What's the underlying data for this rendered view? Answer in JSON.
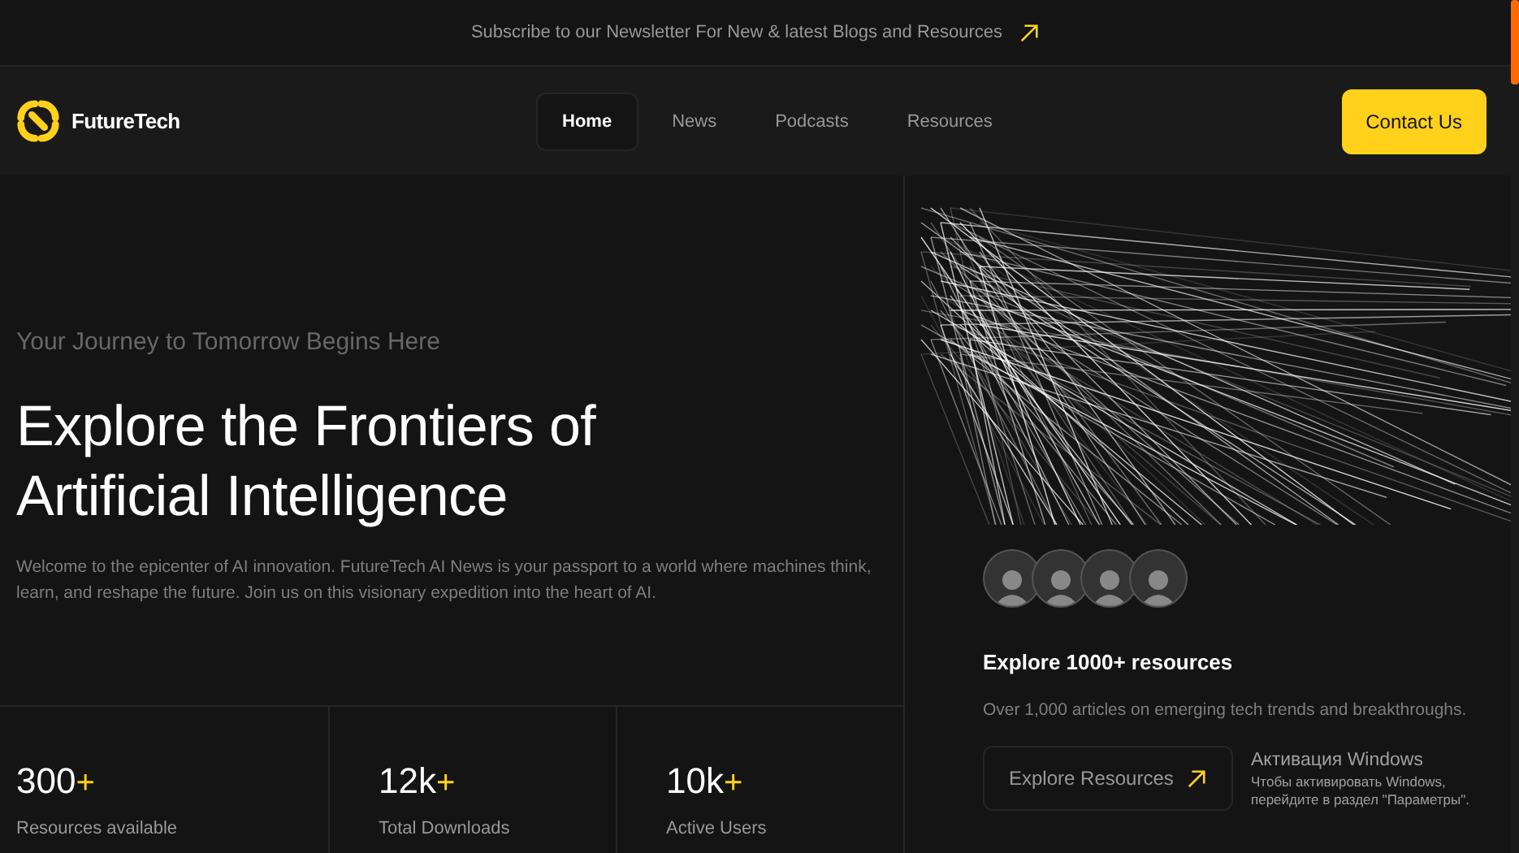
{
  "banner": {
    "text": "Subscribe to our Newsletter For New & latest Blogs and Resources"
  },
  "header": {
    "logo": "FutureTech",
    "nav": [
      {
        "label": "Home",
        "selected": true
      },
      {
        "label": "News",
        "selected": false
      },
      {
        "label": "Podcasts",
        "selected": false
      },
      {
        "label": "Resources",
        "selected": false
      }
    ],
    "cta": "Contact Us"
  },
  "hero": {
    "kicker": "Your Journey to Tomorrow Begins Here",
    "title_lines": [
      "Explore the Frontiers of",
      "Artificial Intelligence"
    ],
    "description": "Welcome to the epicenter of AI innovation. FutureTech AI News is your passport to a world where machines think, learn, and reshape the future. Join us on this visionary expedition into the heart of AI.",
    "stats": [
      {
        "value": "300",
        "suffix": "+",
        "label": "Resources available"
      },
      {
        "value": "12k",
        "suffix": "+",
        "label": "Total Downloads"
      },
      {
        "value": "10k",
        "suffix": "+",
        "label": "Active Users"
      }
    ]
  },
  "side_panel": {
    "title": "Explore 1000+ resources",
    "text": "Over 1,000 articles on emerging tech trends and breakthroughs.",
    "button": "Explore Resources"
  },
  "os_notice": {
    "title": "Активация Windows",
    "text": "Чтобы активировать Windows, перейдите в раздел \"Параметры\"."
  }
}
